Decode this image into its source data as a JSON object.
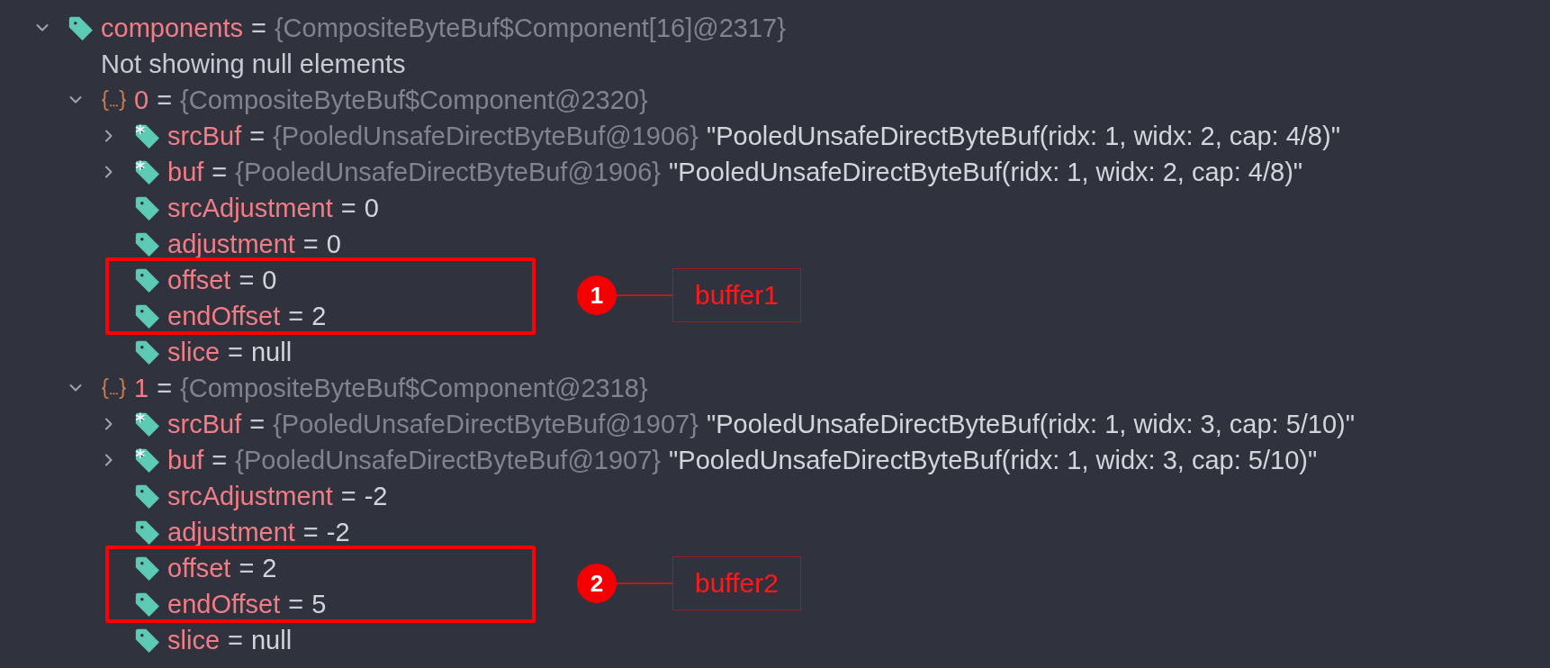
{
  "tree": [
    {
      "kind": "field",
      "marked": false,
      "name": "components",
      "sep": "=",
      "type": "{CompositeByteBuf$Component[16]@2317}",
      "expanded": true,
      "children": [
        {
          "kind": "message",
          "text": "Not showing null elements"
        },
        {
          "kind": "object",
          "name": "0",
          "sep": "=",
          "type": "{CompositeByteBuf$Component@2320}",
          "expanded": true,
          "callout": {
            "number": "1",
            "label": "buffer1"
          },
          "children": [
            {
              "kind": "field",
              "marked": true,
              "name": "srcBuf",
              "sep": "=",
              "type": "{PooledUnsafeDirectByteBuf@1906}",
              "value": "\"PooledUnsafeDirectByteBuf(ridx: 1, widx: 2, cap: 4/8)\"",
              "expanded": false,
              "highlighted": false
            },
            {
              "kind": "field",
              "marked": true,
              "name": "buf",
              "sep": "=",
              "type": "{PooledUnsafeDirectByteBuf@1906}",
              "value": "\"PooledUnsafeDirectByteBuf(ridx: 1, widx: 2, cap: 4/8)\"",
              "expanded": false,
              "highlighted": false
            },
            {
              "kind": "field",
              "marked": false,
              "name": "srcAdjustment",
              "sep": "=",
              "value": "0",
              "highlighted": false
            },
            {
              "kind": "field",
              "marked": false,
              "name": "adjustment",
              "sep": "=",
              "value": "0",
              "highlighted": false
            },
            {
              "kind": "field",
              "marked": false,
              "name": "offset",
              "sep": "=",
              "value": "0",
              "highlighted": true
            },
            {
              "kind": "field",
              "marked": false,
              "name": "endOffset",
              "sep": "=",
              "value": "2",
              "highlighted": true
            },
            {
              "kind": "field",
              "marked": false,
              "name": "slice",
              "sep": "=",
              "value": "null",
              "highlighted": false
            }
          ]
        },
        {
          "kind": "object",
          "name": "1",
          "sep": "=",
          "type": "{CompositeByteBuf$Component@2318}",
          "expanded": true,
          "callout": {
            "number": "2",
            "label": "buffer2"
          },
          "children": [
            {
              "kind": "field",
              "marked": true,
              "name": "srcBuf",
              "sep": "=",
              "type": "{PooledUnsafeDirectByteBuf@1907}",
              "value": "\"PooledUnsafeDirectByteBuf(ridx: 1, widx: 3, cap: 5/10)\"",
              "expanded": false,
              "highlighted": false
            },
            {
              "kind": "field",
              "marked": true,
              "name": "buf",
              "sep": "=",
              "type": "{PooledUnsafeDirectByteBuf@1907}",
              "value": "\"PooledUnsafeDirectByteBuf(ridx: 1, widx: 3, cap: 5/10)\"",
              "expanded": false,
              "highlighted": false
            },
            {
              "kind": "field",
              "marked": false,
              "name": "srcAdjustment",
              "sep": "=",
              "value": "-2",
              "highlighted": false
            },
            {
              "kind": "field",
              "marked": false,
              "name": "adjustment",
              "sep": "=",
              "value": "-2",
              "highlighted": false
            },
            {
              "kind": "field",
              "marked": false,
              "name": "offset",
              "sep": "=",
              "value": "2",
              "highlighted": true
            },
            {
              "kind": "field",
              "marked": false,
              "name": "endOffset",
              "sep": "=",
              "value": "5",
              "highlighted": true
            },
            {
              "kind": "field",
              "marked": false,
              "name": "slice",
              "sep": "=",
              "value": "null",
              "highlighted": false
            }
          ]
        }
      ]
    }
  ]
}
